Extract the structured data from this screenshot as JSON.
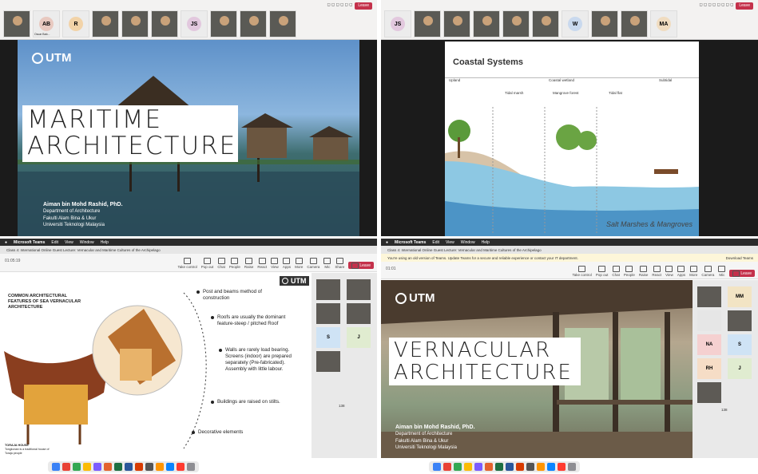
{
  "q1": {
    "toolbar": {
      "leave_label": "Leave"
    },
    "thumbs": [
      {
        "initials": "",
        "name": "",
        "video": true
      },
      {
        "initials": "AB",
        "name": "Oscar Bab...",
        "video": false,
        "color": "#e8c9c0"
      },
      {
        "initials": "R",
        "name": "",
        "video": false,
        "color": "#f2d3a8"
      },
      {
        "initials": "",
        "name": "",
        "video": true
      },
      {
        "initials": "",
        "name": "",
        "video": true
      },
      {
        "initials": "",
        "name": "",
        "video": true
      },
      {
        "initials": "JS",
        "name": "",
        "video": false,
        "color": "#e2c8de"
      },
      {
        "initials": "",
        "name": "",
        "video": true
      },
      {
        "initials": "",
        "name": "",
        "video": true
      },
      {
        "initials": "",
        "name": "",
        "video": true
      }
    ],
    "slide": {
      "logo": "UTM",
      "title_line1": "MARITIME",
      "title_line2": "ARCHITECTURE",
      "author_name": "Aiman bin Mohd Rashid, PhD.",
      "author_lines": [
        "Department of Architecture",
        "Fakulti Alam Bina & Ukur",
        "Universiti Teknologi Malaysia"
      ]
    }
  },
  "q2": {
    "toolbar": {
      "leave_label": "Leave"
    },
    "thumbs": [
      {
        "initials": "JS",
        "name": "",
        "video": false,
        "color": "#e2c8de"
      },
      {
        "initials": "",
        "name": "",
        "video": true
      },
      {
        "initials": "",
        "name": "",
        "video": true
      },
      {
        "initials": "",
        "name": "",
        "video": true
      },
      {
        "initials": "",
        "name": "",
        "video": true
      },
      {
        "initials": "",
        "name": "",
        "video": true
      },
      {
        "initials": "W",
        "name": "",
        "video": false,
        "color": "#c9d9ee"
      },
      {
        "initials": "",
        "name": "",
        "video": true
      },
      {
        "initials": "",
        "name": "",
        "video": true
      },
      {
        "initials": "MA",
        "name": "",
        "video": false,
        "color": "#f0dcc0"
      }
    ],
    "slide": {
      "title": "Coastal Systems",
      "zones": [
        "Upland",
        "Coastal wetland",
        "Subtidal"
      ],
      "subzones": [
        "Tidal marsh",
        "Mangrove forest",
        "Tidal flat"
      ],
      "footer": "Salt Marshes & Mangroves"
    }
  },
  "q3": {
    "menubar": {
      "app": "Microsoft Teams",
      "items": [
        "Edit",
        "View",
        "Window",
        "Help"
      ]
    },
    "tab_title": "Class 4: International Online Guest Lecture: Vernacular and Maritime Cultures of the Archipelago",
    "timer": "01:05:19",
    "tools": [
      "Take control",
      "Pop out",
      "Chat",
      "People",
      "Raise",
      "React",
      "View",
      "Apps",
      "More",
      "Camera",
      "Mic",
      "Share"
    ],
    "leave_label": "Leave",
    "slide": {
      "logo": "UTM",
      "heading": "COMMON ARCHITECTURAL FEATURES OF SEA VERNACULAR ARCHITECTURE",
      "features": [
        "Post and beams method of construction",
        "Roofs are usually the dominant feature-steep / pitched Roof",
        "Walls are rarely load bearing. Screens (indoor) are prepared separately (Pre-fabricated). Assembly with little labour.",
        "Buildings are raised on stilts.",
        "Decorative elements"
      ],
      "caption_title": "TORAJA HOUSE",
      "caption_body": "Tongkonan is a traditional house of Toraja people"
    },
    "tiles": [
      {
        "initials": "",
        "video": true
      },
      {
        "initials": "",
        "video": true
      },
      {
        "initials": "",
        "video": true
      },
      {
        "initials": "",
        "video": true
      },
      {
        "initials": "S",
        "video": false,
        "color": "#cfe3f5"
      },
      {
        "initials": "J",
        "video": false,
        "color": "#e0ecd0"
      },
      {
        "initials": "",
        "video": true
      }
    ],
    "page_count": "138"
  },
  "q4": {
    "menubar": {
      "app": "Microsoft Teams",
      "items": [
        "Edit",
        "View",
        "Window",
        "Help"
      ]
    },
    "tab_title": "Class 4: International Online Guest Lecture: Vernacular and Maritime Cultures of the Archipelago",
    "warning": "You're using an old version of Teams. Update Teams for a secure and reliable experience or contact your IT department.",
    "warning_action": "Download Teams",
    "timer": "01:01",
    "leave_label": "Leave",
    "slide": {
      "logo": "UTM",
      "title_line1": "VERNACULAR",
      "title_line2": "ARCHITECTURE",
      "author_name": "Aiman bin Mohd Rashid, PhD.",
      "author_lines": [
        "Department of Architecture",
        "Fakulti Alam Bina & Ukur",
        "Universiti Teknologi Malaysia"
      ]
    },
    "tiles": [
      {
        "initials": "",
        "video": true
      },
      {
        "initials": "MM",
        "video": false,
        "color": "#f2e4c4"
      },
      {
        "initials": "",
        "video": false,
        "color": "#e6e6e6"
      },
      {
        "initials": "",
        "video": true
      },
      {
        "initials": "NA",
        "video": false,
        "color": "#f5d0d0"
      },
      {
        "initials": "S",
        "video": false,
        "color": "#cfe3f5"
      },
      {
        "initials": "RH",
        "video": false,
        "color": "#f6ddc6"
      },
      {
        "initials": "J",
        "video": false,
        "color": "#e0ecd0"
      },
      {
        "initials": "",
        "video": true
      }
    ],
    "page_count": "138"
  }
}
